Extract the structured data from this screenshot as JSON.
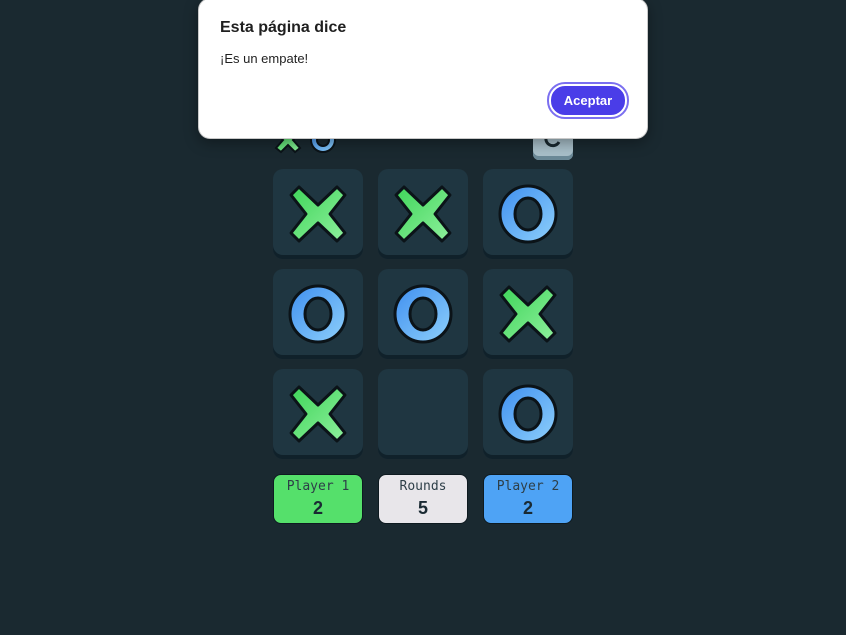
{
  "dialog": {
    "title": "Esta página dice",
    "message": "¡Es un empate!",
    "ok_label": "Aceptar"
  },
  "board": [
    {
      "mark": "X"
    },
    {
      "mark": "X"
    },
    {
      "mark": "O"
    },
    {
      "mark": "O"
    },
    {
      "mark": "O"
    },
    {
      "mark": "X"
    },
    {
      "mark": "X"
    },
    {
      "mark": ""
    },
    {
      "mark": "O"
    }
  ],
  "scores": {
    "player1": {
      "label": "Player 1",
      "value": "2"
    },
    "rounds": {
      "label": "Rounds",
      "value": "5"
    },
    "player2": {
      "label": "Player 2",
      "value": "2"
    }
  },
  "colors": {
    "background": "#1a2930",
    "cell": "#1f3641",
    "x": "#55e06b",
    "o": "#4ea3f5",
    "accent": "#4a3de8"
  },
  "icons": {
    "logo": "xo-logo-icon",
    "restart": "restart-icon",
    "x_mark": "x-mark-icon",
    "o_mark": "o-mark-icon"
  }
}
